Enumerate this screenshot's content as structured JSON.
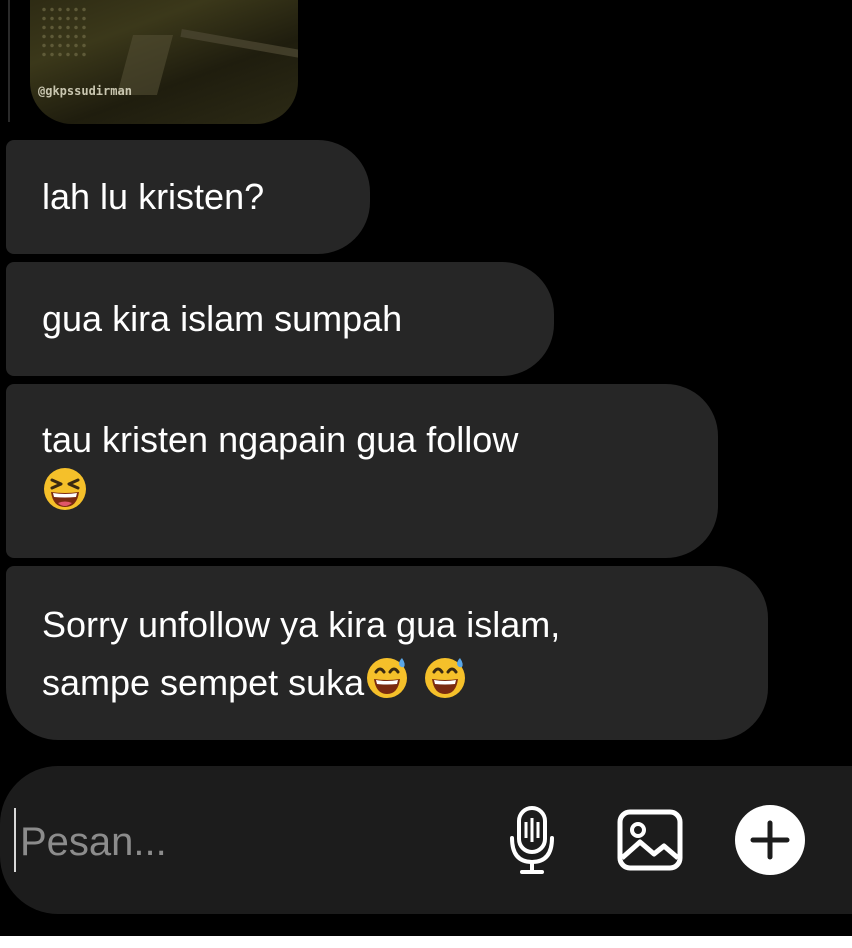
{
  "story": {
    "handle": "@gkpssudirman"
  },
  "messages": [
    {
      "text": "lah lu kristen?",
      "emojis": []
    },
    {
      "text": "gua kira islam sumpah",
      "emojis": []
    },
    {
      "text": "tau kristen ngapain gua follow",
      "emojis": [
        "laughing-squint-emoji"
      ]
    },
    {
      "text": "Sorry unfollow ya kira gua islam,\nsampe sempet suka",
      "emojis": [
        "grinning-sweat-emoji",
        "grinning-sweat-emoji"
      ]
    }
  ],
  "composer": {
    "placeholder": "Pesan...",
    "value": ""
  },
  "icons": {
    "microphone": "microphone-icon",
    "gallery": "gallery-icon",
    "add": "plus-circle-icon"
  },
  "colors": {
    "background": "#000000",
    "bubble": "#262626",
    "composer": "#1c1c1c",
    "text": "#ffffff",
    "placeholder": "#8c8c8c"
  }
}
